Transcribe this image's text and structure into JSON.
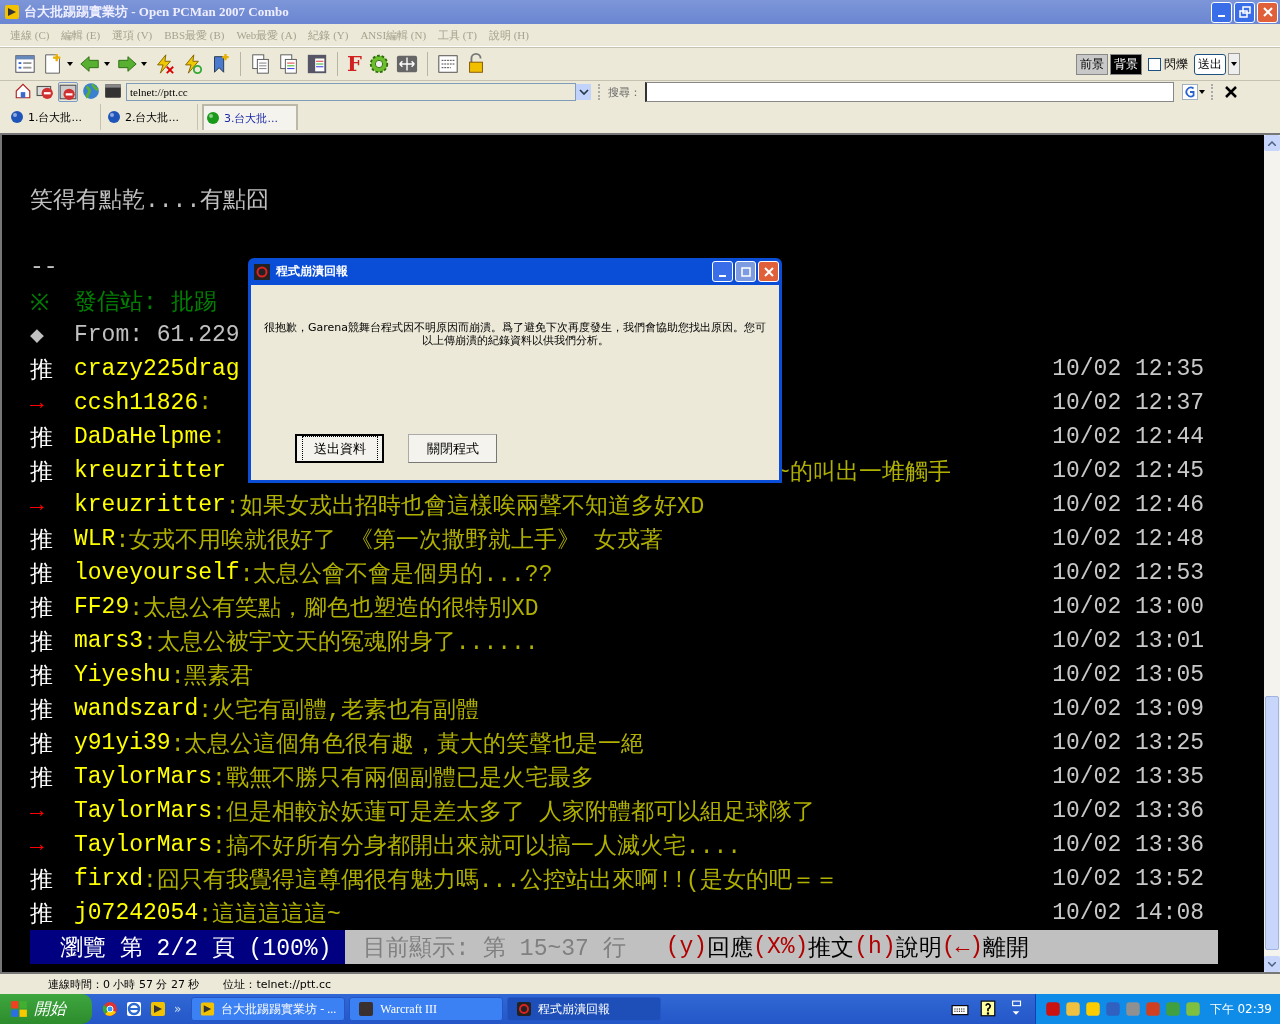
{
  "window": {
    "title": "台大批踢踢實業坊 - Open PCMan 2007 Combo"
  },
  "menu": [
    "連線 (C)",
    "編輯 (E)",
    "選項 (V)",
    "BBS最愛 (B)",
    "Web最愛 (A)",
    "紀錄 (Y)",
    "ANSI編輯 (N)",
    "工具 (T)",
    "說明 (H)"
  ],
  "toolbar": {
    "font_icon": "F",
    "foreground": "前景",
    "background": "背景",
    "blink": {
      "label": "閃爍",
      "checked": false
    },
    "send": "送出"
  },
  "address": {
    "value": "telnet://ptt.cc",
    "search_label": "搜尋："
  },
  "tabs": [
    {
      "label": "1.台大批...",
      "selected": false
    },
    {
      "label": "2.台大批...",
      "selected": false
    },
    {
      "label": "3.台大批...",
      "selected": true
    }
  ],
  "terminal": {
    "lines": [
      {
        "text": "笑得有點乾....有點囧",
        "kind": "body"
      },
      {
        "kind": "blank"
      },
      {
        "text": "--",
        "kind": "sig"
      },
      {
        "mark": "※",
        "text": "發信站: 批踢",
        "kind": "site"
      },
      {
        "mark": "◆",
        "text": "From: 61.229",
        "kind": "from"
      }
    ],
    "comments": [
      {
        "mark": "推",
        "kind": "push",
        "user": "crazy225drag",
        "time": "10/02 12:35"
      },
      {
        "mark": "→",
        "kind": "arrow",
        "user": "ccsh11826",
        "text": ":",
        "time": "10/02 12:37"
      },
      {
        "mark": "推",
        "kind": "push",
        "user": "DaDaHelpme",
        "text": ":",
        "time": "10/02 12:44"
      },
      {
        "mark": "推",
        "kind": "push",
        "user": "kreuzritter",
        "tail": "~的叫出一堆觸手",
        "time": "10/02 12:45"
      },
      {
        "mark": "→",
        "kind": "arrow",
        "user": "kreuzritter",
        "text": ":如果女戎出招時也會這樣唉兩聲不知道多好XD",
        "time": "10/02 12:46"
      },
      {
        "mark": "推",
        "kind": "push",
        "user": "WLR",
        "text": ":女戎不用唉就很好了 《第一次撒野就上手》 女戎著",
        "time": "10/02 12:48"
      },
      {
        "mark": "推",
        "kind": "push",
        "user": "loveyourself",
        "text": ":太息公會不會是個男的...??",
        "time": "10/02 12:53"
      },
      {
        "mark": "推",
        "kind": "push",
        "user": "FF29",
        "text": ":太息公有笑點，腳色也塑造的很特別XD",
        "time": "10/02 13:00"
      },
      {
        "mark": "推",
        "kind": "push",
        "user": "mars3",
        "text": ":太息公被宇文天的冤魂附身了......",
        "time": "10/02 13:01"
      },
      {
        "mark": "推",
        "kind": "push",
        "user": "Yiyeshu",
        "text": ":黑素君",
        "time": "10/02 13:05"
      },
      {
        "mark": "推",
        "kind": "push",
        "user": "wandszard",
        "text": ":火宅有副體,老素也有副體",
        "time": "10/02 13:09"
      },
      {
        "mark": "推",
        "kind": "push",
        "user": "y91yi39",
        "text": ":太息公這個角色很有趣，黃大的笑聲也是一絕",
        "time": "10/02 13:25"
      },
      {
        "mark": "推",
        "kind": "push",
        "user": "TaylorMars",
        "text": ":戰無不勝只有兩個副體已是火宅最多",
        "time": "10/02 13:35"
      },
      {
        "mark": "→",
        "kind": "arrow",
        "user": "TaylorMars",
        "text": ":但是相較於妖蓮可是差太多了 人家附體都可以組足球隊了",
        "time": "10/02 13:36"
      },
      {
        "mark": "→",
        "kind": "arrow",
        "user": "TaylorMars",
        "text": ":搞不好所有分身都開出來就可以搞一人滅火宅....",
        "time": "10/02 13:36"
      },
      {
        "mark": "推",
        "kind": "push",
        "user": "firxd",
        "text": ":囧只有我覺得這尊偶很有魅力嗎...公控站出來啊!!(是女的吧＝＝",
        "time": "10/02 13:52"
      },
      {
        "mark": "推",
        "kind": "push",
        "user": "j07242054",
        "text": ":這這這這這~",
        "time": "10/02 14:08"
      }
    ],
    "footer": {
      "page": "瀏覽 第 2/2 頁 (100%)",
      "range": "目前顯示: 第 15~37 行",
      "keys": [
        {
          "text": "(y)",
          "kind": "key"
        },
        {
          "text": "回應",
          "kind": "label"
        },
        {
          "text": "(X%)",
          "kind": "key"
        },
        {
          "text": "推文",
          "kind": "label"
        },
        {
          "text": "(h)",
          "kind": "key"
        },
        {
          "text": "說明",
          "kind": "label"
        },
        {
          "text": "(←)",
          "kind": "key"
        },
        {
          "text": "離開",
          "kind": "label"
        }
      ]
    }
  },
  "dialog": {
    "title": "程式崩潰回報",
    "message": "很抱歉，Garena競舞台程式因不明原因而崩潰。爲了避免下次再度發生，我們會協助您找出原因。您可以上傳崩潰的紀錄資料以供我們分析。",
    "buttons": [
      {
        "label": "送出資料",
        "selected": true
      },
      {
        "label": "關閉程式",
        "selected": false
      }
    ]
  },
  "status_bar": {
    "time": "連線時間：0 小時 57 分 27 秒",
    "address": "位址：telnet://ptt.cc"
  },
  "taskbar": {
    "start": "開始",
    "more": "»",
    "tasks": [
      {
        "label": "台大批踢踢實業坊 - ...",
        "selected": false
      },
      {
        "label": "Warcraft III",
        "selected": false
      },
      {
        "label": "程式崩潰回報",
        "selected": true
      }
    ],
    "clock": "下午 02:39"
  }
}
